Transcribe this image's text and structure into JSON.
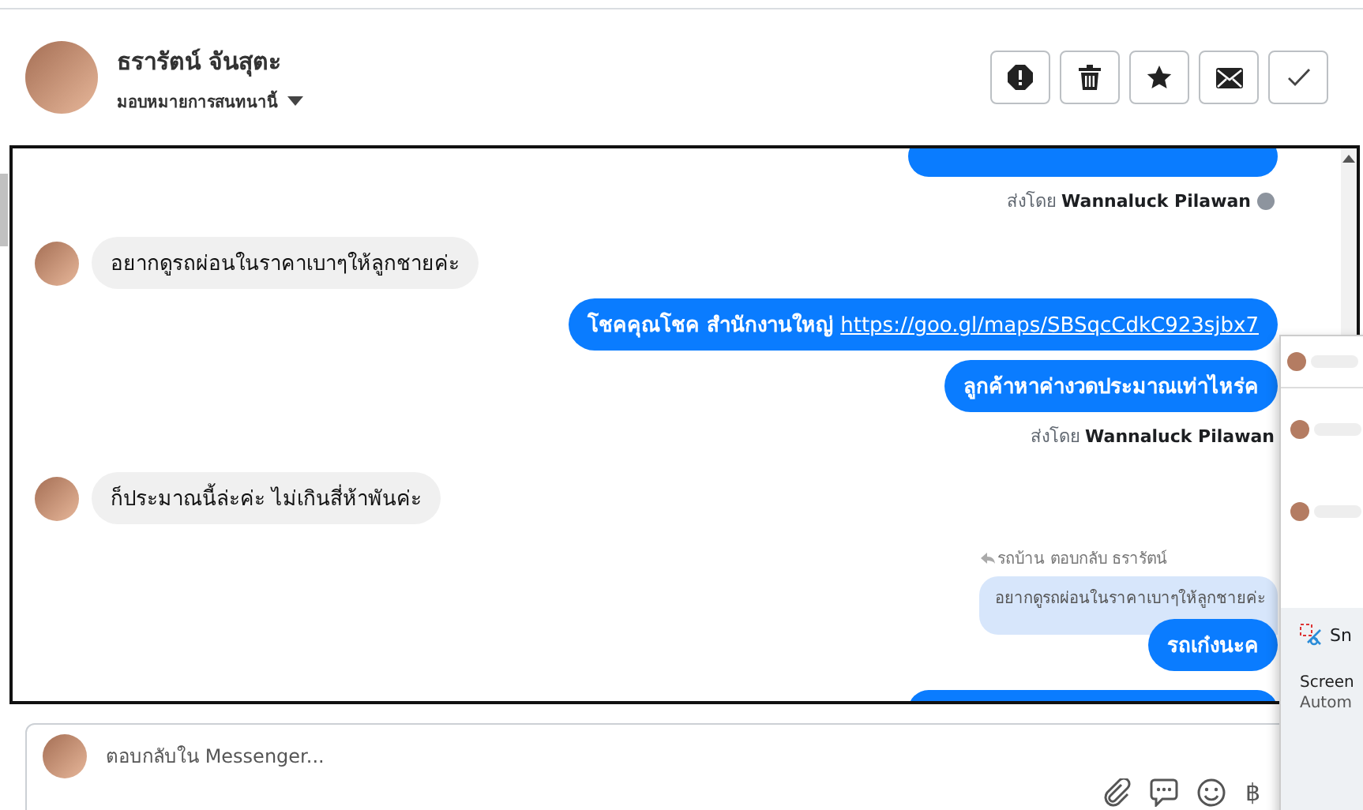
{
  "header": {
    "name": "ธรารัตน์ จันสุตะ",
    "assign_label": "มอบหมายการสนทนานี้",
    "actions": [
      {
        "kind": "report"
      },
      {
        "kind": "delete"
      },
      {
        "kind": "star"
      },
      {
        "kind": "mail"
      },
      {
        "kind": "done"
      }
    ]
  },
  "messages": [
    {
      "kind": "blank_outgoing"
    },
    {
      "kind": "sent_by",
      "prefix": "ส่งโดย",
      "name": "Wannaluck Pilawan",
      "help": true
    },
    {
      "kind": "incoming",
      "text": "อยากดูรถผ่อนในราคาเบาๆให้ลูกชายค่ะ"
    },
    {
      "kind": "outgoing",
      "text": "โชคคุณโชค สำนักงานใหญ่",
      "link": "https://goo.gl/maps/SBSqcCdkC923sjbx7"
    },
    {
      "kind": "outgoing",
      "text": "ลูกค้าหาค่างวดประมาณเท่าไหร่ค"
    },
    {
      "kind": "sent_by",
      "prefix": "ส่งโดย",
      "name": "Wannaluck Pilawan",
      "help": false
    },
    {
      "kind": "incoming",
      "text": "ก็ประมาณนี้ล่ะค่ะ ไม่เกินสี่ห้าพันค่ะ"
    },
    {
      "kind": "reply_label",
      "text": "รถบ้าน ตอบกลับ ธรารัตน์"
    },
    {
      "kind": "quote",
      "text": "อยากดูรถผ่อนในราคาเบาๆให้ลูกชายค่ะ"
    },
    {
      "kind": "outgoing",
      "text": "รถเก๋งนะค"
    },
    {
      "kind": "blank_outgoing"
    }
  ],
  "composer": {
    "placeholder": "ตอบกลับใน Messenger...",
    "tools": [
      {
        "kind": "attach"
      },
      {
        "kind": "saved_reply"
      },
      {
        "kind": "emoji"
      },
      {
        "kind": "currency",
        "symbol": "฿"
      }
    ]
  },
  "notification": {
    "app": "Sn",
    "title": "Screen",
    "body": "Autom"
  }
}
